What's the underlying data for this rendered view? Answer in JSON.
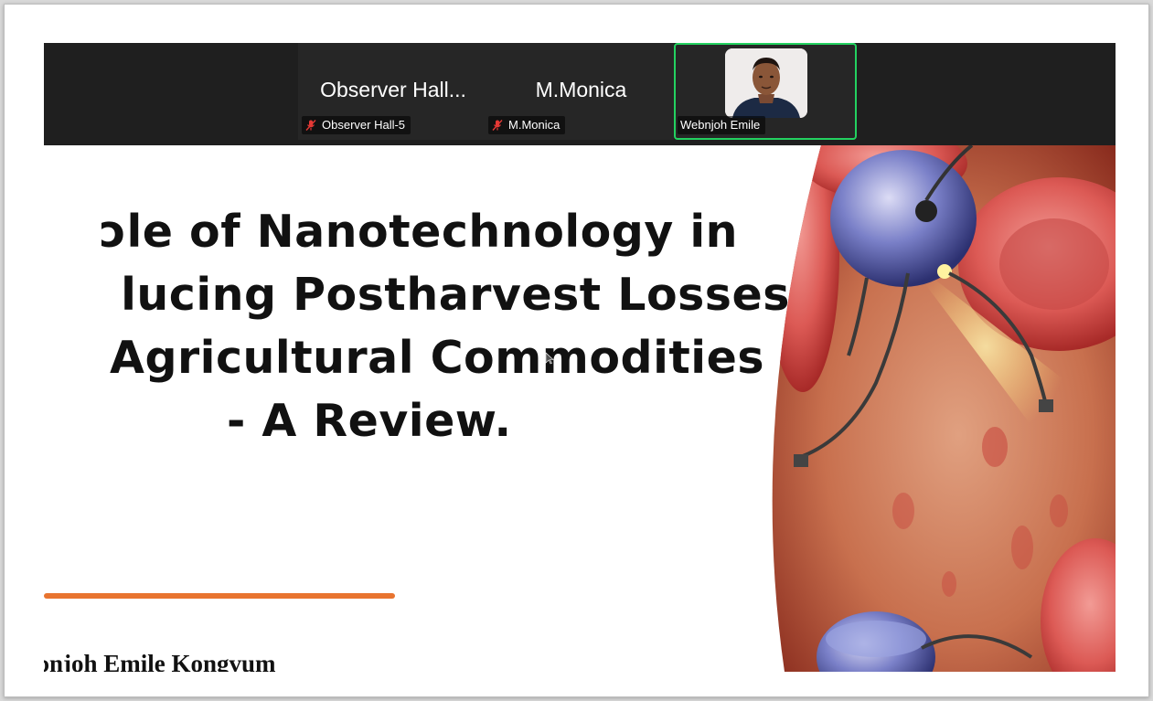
{
  "meeting": {
    "participants": [
      {
        "display_name": "Observer Hall...",
        "label": "Observer Hall-5",
        "muted": true
      },
      {
        "display_name": "M.Monica",
        "label": "M.Monica",
        "muted": true
      },
      {
        "label": "Webnjoh Emile",
        "active_speaker": true
      }
    ]
  },
  "slide": {
    "title_lines": [
      "ɔle of Nanotechnology in",
      "lucing Postharvest Losses",
      "Agricultural Commodities",
      "- A Review."
    ],
    "author": "ɔnjoh Emile Kongvum"
  },
  "colors": {
    "accent_rule": "#e8742f",
    "active_speaker_border": "#23d160",
    "strip_bg": "#1f1f1f"
  },
  "icons": {
    "mute": "microphone-muted-icon"
  }
}
